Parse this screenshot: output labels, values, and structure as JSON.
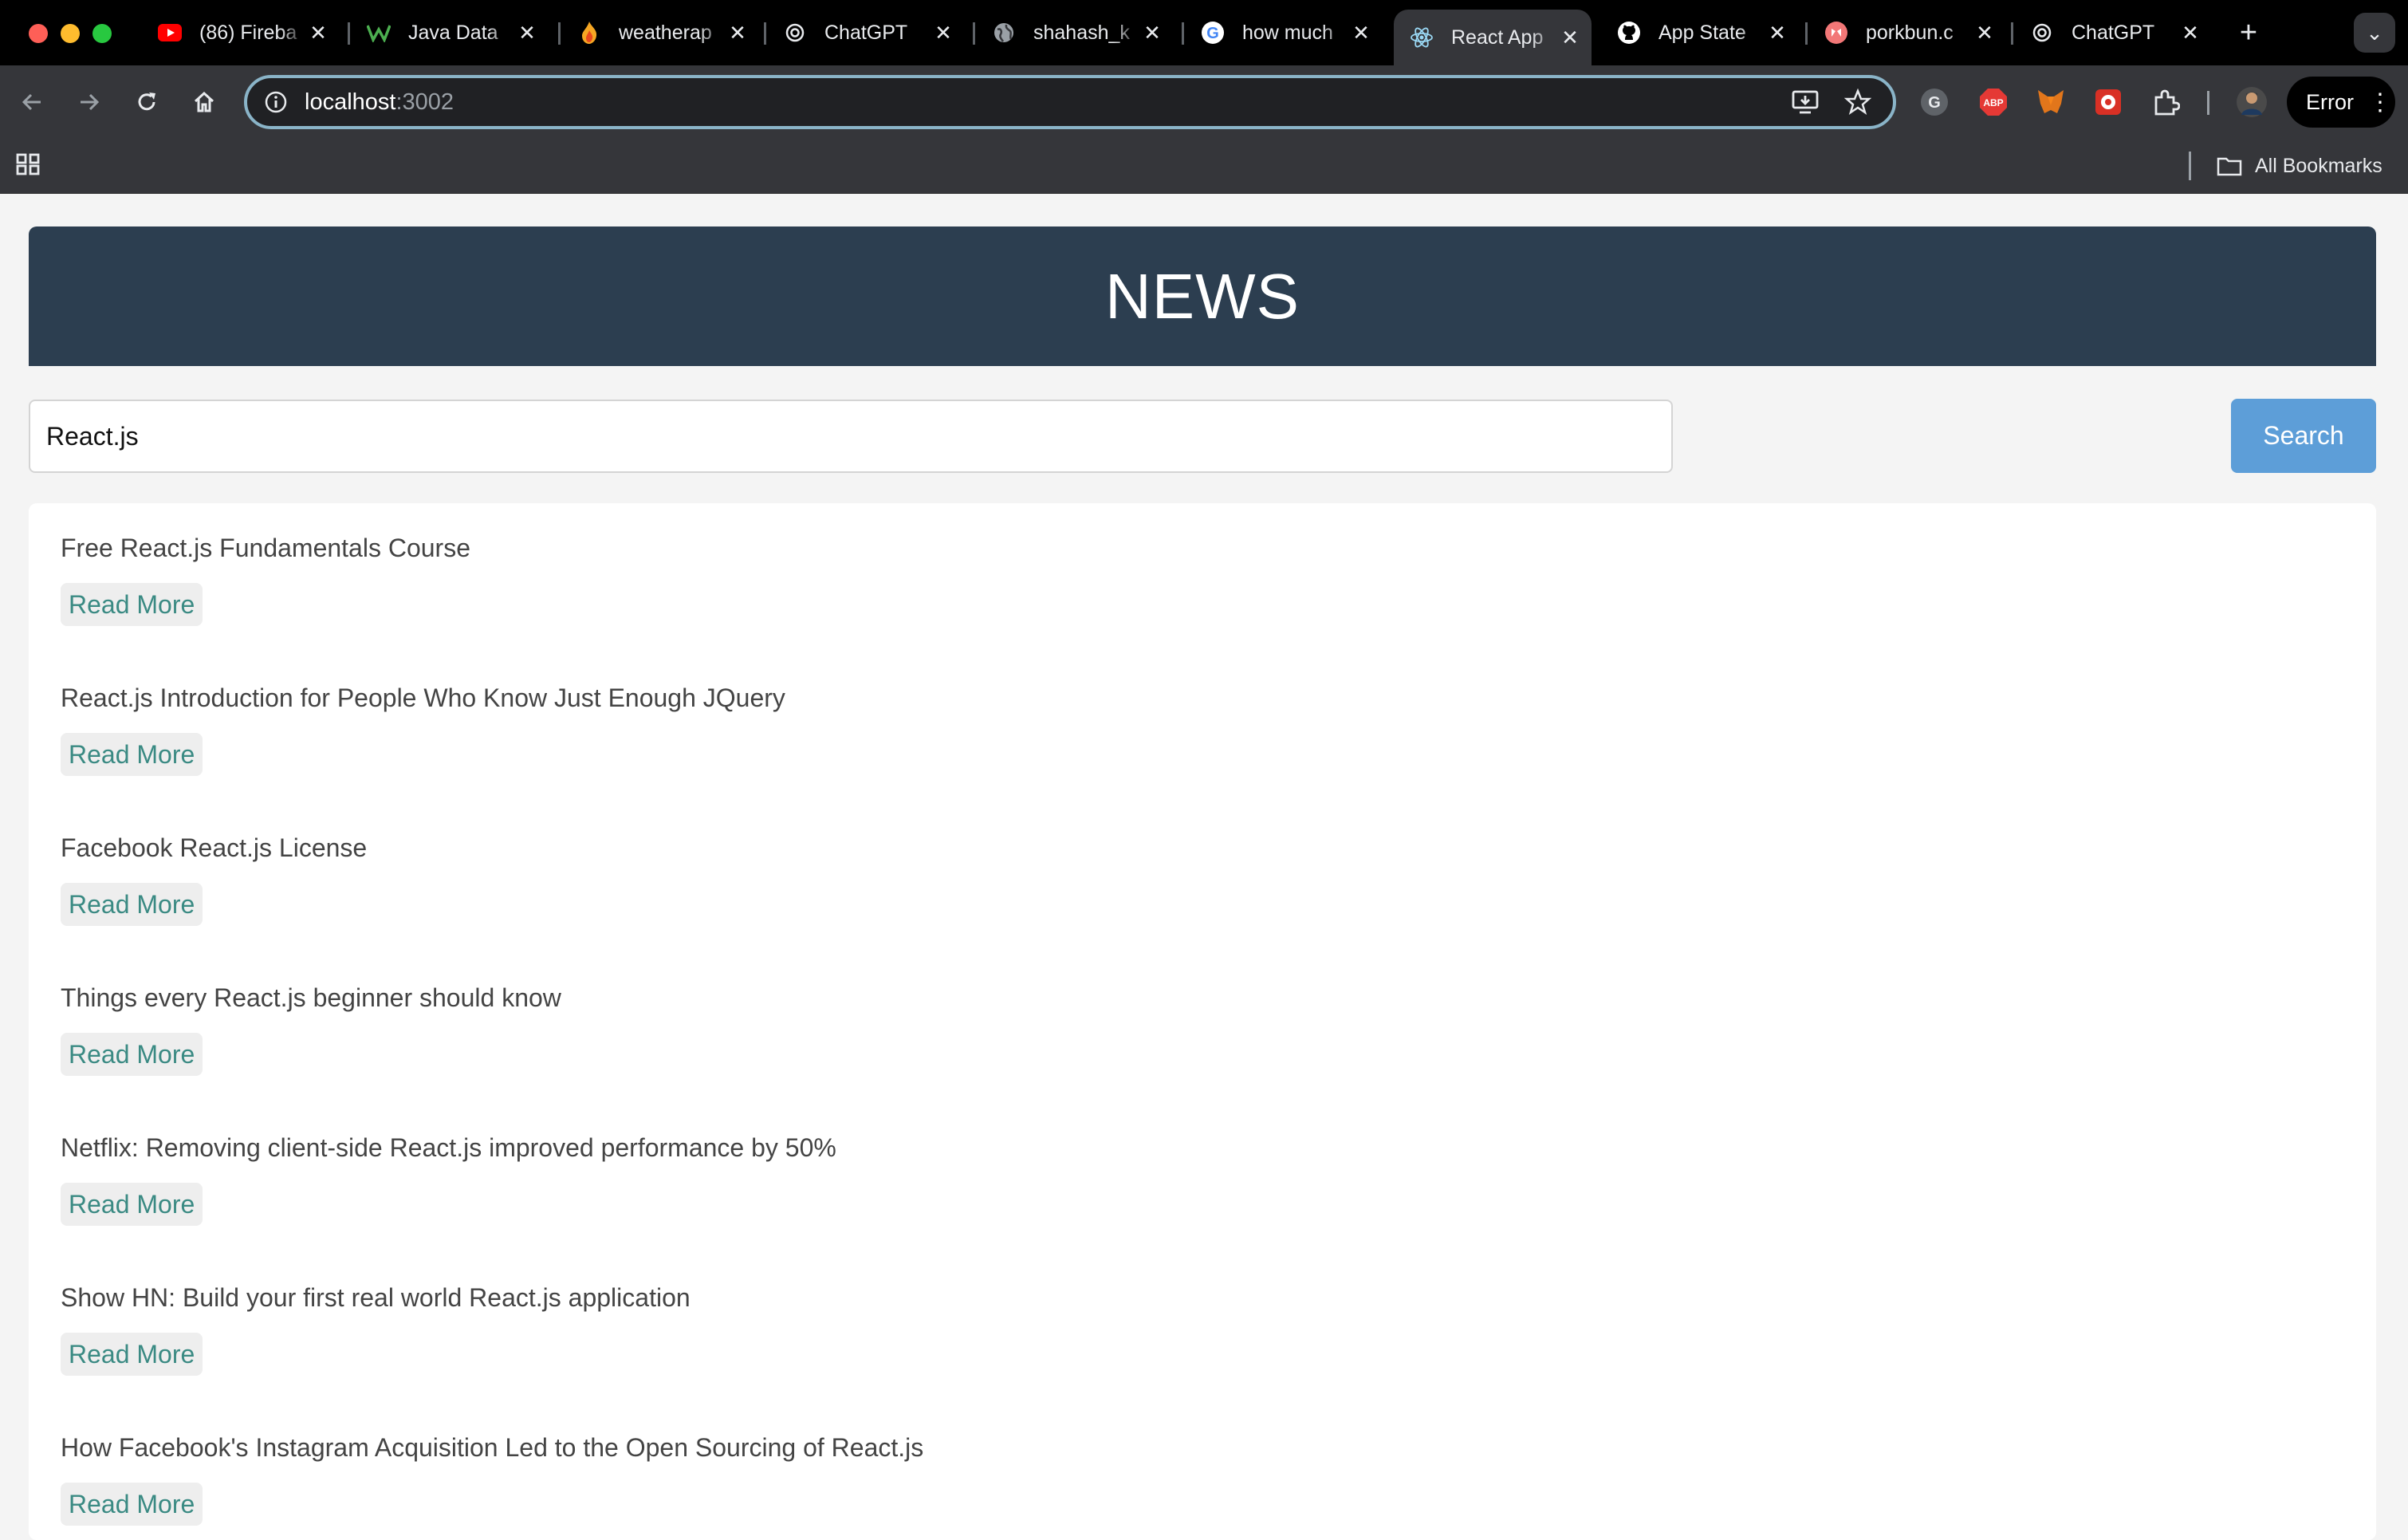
{
  "browser": {
    "tabs": [
      {
        "title": "(86) Fireba",
        "icon": "youtube-icon",
        "active": false
      },
      {
        "title": "Java Data",
        "icon": "w-logo-icon",
        "active": false
      },
      {
        "title": "weatherap",
        "icon": "flame-icon",
        "active": false
      },
      {
        "title": "ChatGPT",
        "icon": "openai-icon",
        "active": false
      },
      {
        "title": "shahash_k",
        "icon": "globe-icon",
        "active": false
      },
      {
        "title": "how much",
        "icon": "google-icon",
        "active": false
      },
      {
        "title": "React App",
        "icon": "react-icon",
        "active": true
      },
      {
        "title": "App State",
        "icon": "github-icon",
        "active": false
      },
      {
        "title": "porkbun.c",
        "icon": "porkbun-icon",
        "active": false
      },
      {
        "title": "ChatGPT",
        "icon": "openai-icon",
        "active": false
      }
    ],
    "url_host": "localhost",
    "url_port": ":3002",
    "profile_status": "Error",
    "bookmarks_label": "All Bookmarks"
  },
  "page": {
    "header_title": "NEWS",
    "search_value": "React.js",
    "search_button": "Search",
    "articles": [
      {
        "title": "Free React.js Fundamentals Course",
        "link_label": "Read More"
      },
      {
        "title": "React.js Introduction for People Who Know Just Enough JQuery",
        "link_label": "Read More"
      },
      {
        "title": "Facebook React.js License",
        "link_label": "Read More"
      },
      {
        "title": "Things every React.js beginner should know",
        "link_label": "Read More"
      },
      {
        "title": "Netflix: Removing client-side React.js improved performance by 50%",
        "link_label": "Read More"
      },
      {
        "title": "Show HN: Build your first real world React.js application",
        "link_label": "Read More"
      },
      {
        "title": "How Facebook's Instagram Acquisition Led to the Open Sourcing of React.js",
        "link_label": "Read More"
      }
    ]
  },
  "colors": {
    "header_bg": "#2c3e50",
    "search_button_bg": "#5d9ed8",
    "read_more_text": "#3a8a83"
  }
}
